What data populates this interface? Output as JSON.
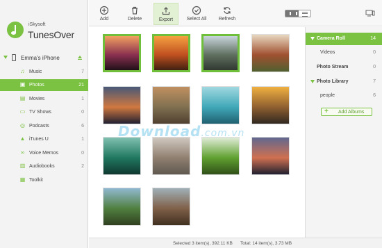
{
  "app": {
    "vendor": "iSkysoft",
    "title": "TunesOver"
  },
  "device": {
    "name": "Emma's iPhone"
  },
  "sidebar": {
    "items": [
      {
        "label": "Music",
        "count": "7",
        "icon": "music-note-icon",
        "glyph": "♫"
      },
      {
        "label": "Photos",
        "count": "21",
        "icon": "photo-icon",
        "glyph": "▣",
        "active": true
      },
      {
        "label": "Movies",
        "count": "1",
        "icon": "film-icon",
        "glyph": "▤"
      },
      {
        "label": "TV Shows",
        "count": "0",
        "icon": "tv-icon",
        "glyph": "▭"
      },
      {
        "label": "Podcasts",
        "count": "6",
        "icon": "podcast-icon",
        "glyph": "◎"
      },
      {
        "label": "iTunes U",
        "count": "1",
        "icon": "graduation-cap-icon",
        "glyph": "▲"
      },
      {
        "label": "Voice Memos",
        "count": "0",
        "icon": "voicemail-icon",
        "glyph": "∞"
      },
      {
        "label": "Audiobooks",
        "count": "2",
        "icon": "book-icon",
        "glyph": "▥"
      },
      {
        "label": "Toolkit",
        "count": "",
        "icon": "toolkit-icon",
        "glyph": "▦"
      }
    ]
  },
  "toolbar": {
    "add": "Add",
    "delete": "Delete",
    "export": "Export",
    "select_all": "Select All",
    "refresh": "Refresh",
    "view_mode": "grid"
  },
  "albums": {
    "camera_roll": {
      "label": "Camera Roll",
      "count": "14"
    },
    "videos": {
      "label": "Videos",
      "count": "0"
    },
    "photo_stream": {
      "label": "Photo Stream",
      "count": "0"
    },
    "photo_library": {
      "label": "Photo Library",
      "count": "7"
    },
    "people": {
      "label": "people",
      "count": "6"
    },
    "add_label": "Add Albums"
  },
  "photos": [
    {
      "name": "sunset-palm",
      "selected": true,
      "colors": [
        "#f0a060",
        "#8a3050",
        "#201018"
      ]
    },
    {
      "name": "sunset-lake",
      "selected": true,
      "colors": [
        "#f4a040",
        "#c05020",
        "#402010"
      ]
    },
    {
      "name": "mountain-lake",
      "selected": true,
      "colors": [
        "#c8d4dc",
        "#607060",
        "#303830"
      ]
    },
    {
      "name": "food-plates",
      "selected": false,
      "colors": [
        "#e8d8c0",
        "#a05030",
        "#506030"
      ]
    },
    {
      "name": "night-beach",
      "selected": false,
      "colors": [
        "#485878",
        "#d07840",
        "#202030"
      ]
    },
    {
      "name": "autumn-path",
      "selected": false,
      "colors": [
        "#c09060",
        "#807050",
        "#504030"
      ]
    },
    {
      "name": "wave-turquoise",
      "selected": false,
      "colors": [
        "#a0d8e0",
        "#40a8b8",
        "#206070"
      ]
    },
    {
      "name": "dusk-pier",
      "selected": false,
      "colors": [
        "#f0b040",
        "#906030",
        "#302820"
      ]
    },
    {
      "name": "green-wave",
      "selected": false,
      "colors": [
        "#80c0b0",
        "#207860",
        "#103830"
      ]
    },
    {
      "name": "tabby-cat",
      "selected": false,
      "colors": [
        "#d0c8c0",
        "#908070",
        "#605850"
      ]
    },
    {
      "name": "green-plant",
      "selected": false,
      "colors": [
        "#e0ecd8",
        "#60a030",
        "#305018"
      ]
    },
    {
      "name": "dusk-clouds",
      "selected": false,
      "colors": [
        "#606890",
        "#d07050",
        "#202030"
      ]
    },
    {
      "name": "forest-trees",
      "selected": false,
      "colors": [
        "#90b8d0",
        "#508040",
        "#304020"
      ]
    },
    {
      "name": "tree-trunks",
      "selected": false,
      "colors": [
        "#a0b0b8",
        "#806048",
        "#403020"
      ]
    }
  ],
  "status": {
    "selected": "Selected 3 item(s), 392.11 KB",
    "total": "Total: 14 item(s), 3.73 MB"
  },
  "watermark": {
    "main": "Download",
    "suffix": ".com.vn"
  }
}
